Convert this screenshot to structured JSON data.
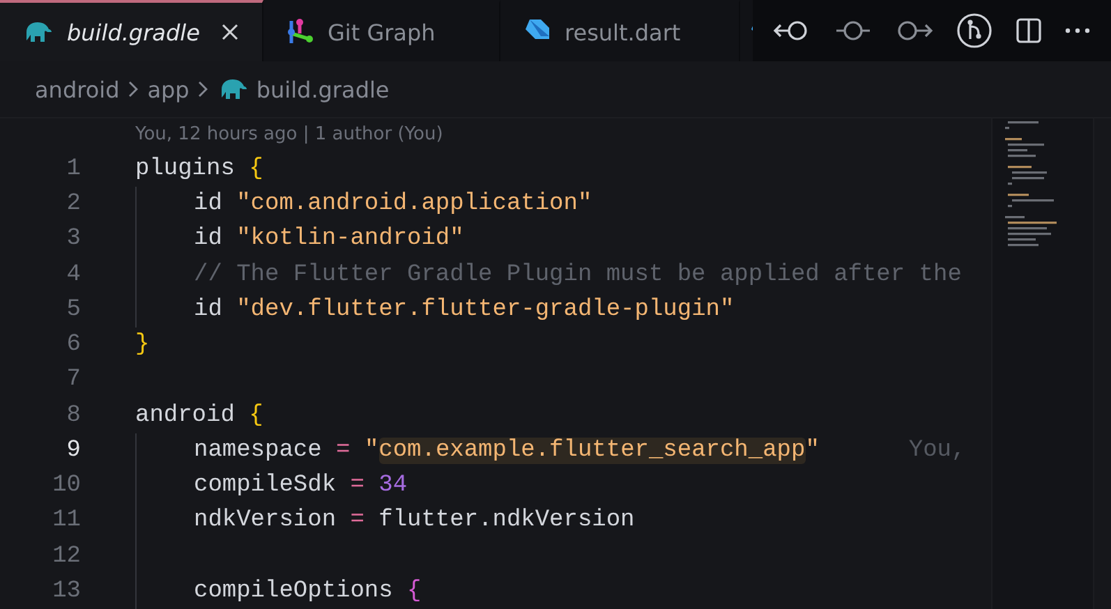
{
  "tabs": [
    {
      "label": "build.gradle",
      "kind": "gradle",
      "selected": true,
      "closable": true
    },
    {
      "label": "Git Graph",
      "kind": "git-graph",
      "selected": false,
      "closable": false
    },
    {
      "label": "result.dart",
      "kind": "dart",
      "selected": false,
      "closable": false
    },
    {
      "kind": "dart",
      "selected": false
    }
  ],
  "breadcrumbs": [
    {
      "label": "android",
      "kind": "folder"
    },
    {
      "label": "app",
      "kind": "folder"
    },
    {
      "label": "build.gradle",
      "kind": "gradle"
    }
  ],
  "blame_header": "You, 12 hours ago | 1 author (You)",
  "lines": [
    {
      "number": "1",
      "current": false,
      "guide": false,
      "tokens": [
        {
          "kind": "plain",
          "text": "plugins "
        },
        {
          "kind": "brace",
          "text": "{"
        }
      ]
    },
    {
      "number": "2",
      "current": false,
      "guide": true,
      "tokens": [
        {
          "kind": "plain",
          "text": "id "
        },
        {
          "kind": "string",
          "text": "\"com.android.application\""
        }
      ]
    },
    {
      "number": "3",
      "current": false,
      "guide": true,
      "tokens": [
        {
          "kind": "plain",
          "text": "id "
        },
        {
          "kind": "string",
          "text": "\"kotlin-android\""
        }
      ]
    },
    {
      "number": "4",
      "current": false,
      "guide": true,
      "tokens": [
        {
          "kind": "comment",
          "text": "// The Flutter Gradle Plugin must be applied after the"
        }
      ]
    },
    {
      "number": "5",
      "current": false,
      "guide": true,
      "tokens": [
        {
          "kind": "plain",
          "text": "id "
        },
        {
          "kind": "string",
          "text": "\"dev.flutter.flutter-gradle-plugin\""
        }
      ]
    },
    {
      "number": "6",
      "current": false,
      "guide": false,
      "tokens": [
        {
          "kind": "brace",
          "text": "}"
        }
      ]
    },
    {
      "number": "7",
      "current": false,
      "guide": false
    },
    {
      "number": "8",
      "current": false,
      "guide": false,
      "tokens": [
        {
          "kind": "plain",
          "text": "android "
        },
        {
          "kind": "brace",
          "text": "{"
        }
      ]
    },
    {
      "number": "9",
      "current": true,
      "guide": true,
      "blame": "You,",
      "tokens": [
        {
          "kind": "plain",
          "text": "namespace "
        },
        {
          "kind": "operator",
          "text": "= "
        },
        {
          "kind": "string",
          "text": "\""
        },
        {
          "kind": "highlight",
          "text": "com.example.flutter_search_app"
        },
        {
          "kind": "string",
          "text": "\""
        }
      ]
    },
    {
      "number": "10",
      "current": false,
      "guide": true,
      "tokens": [
        {
          "kind": "plain",
          "text": "compileSdk "
        },
        {
          "kind": "operator",
          "text": "= "
        },
        {
          "kind": "number",
          "text": "34"
        }
      ]
    },
    {
      "number": "11",
      "current": false,
      "guide": true,
      "tokens": [
        {
          "kind": "plain",
          "text": "ndkVersion "
        },
        {
          "kind": "operator",
          "text": "= "
        },
        {
          "kind": "plain",
          "text": "flutter.ndkVersion"
        }
      ]
    },
    {
      "number": "12",
      "current": false,
      "guide": true
    },
    {
      "number": "13",
      "current": false,
      "guide": true,
      "tokens": [
        {
          "kind": "plain",
          "text": "compileOptions "
        },
        {
          "kind": "brace2",
          "text": "{"
        }
      ]
    }
  ]
}
